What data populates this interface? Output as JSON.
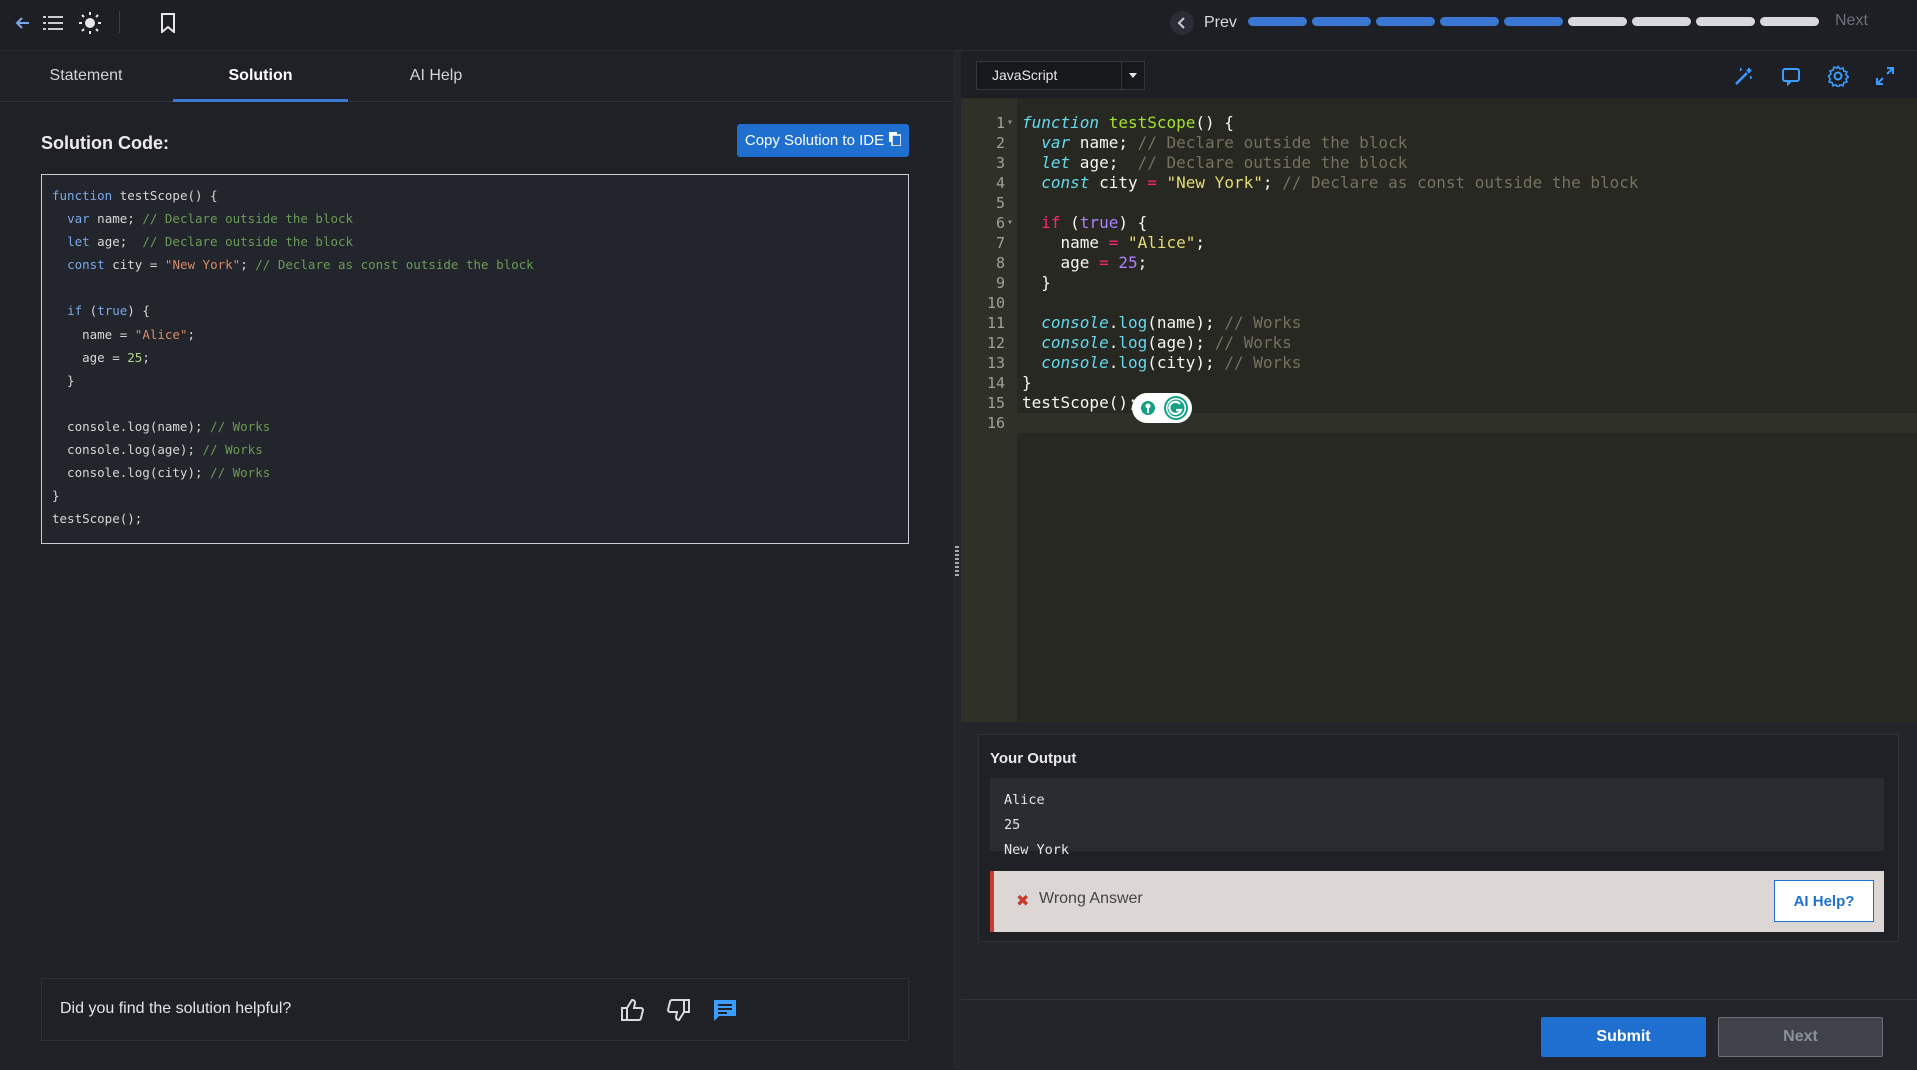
{
  "topbar": {
    "prev_label": "Prev",
    "next_label": "Next",
    "progress": {
      "completed": 5,
      "total": 9
    }
  },
  "tabs": [
    "Statement",
    "Solution",
    "AI Help"
  ],
  "active_tab": "Solution",
  "solution": {
    "title": "Solution Code:",
    "copy_button": "Copy Solution to IDE"
  },
  "feedback": {
    "question": "Did you find the solution helpful?"
  },
  "editor": {
    "language": "JavaScript",
    "line_numbers": [
      "1",
      "2",
      "3",
      "4",
      "5",
      "6",
      "7",
      "8",
      "9",
      "10",
      "11",
      "12",
      "13",
      "14",
      "15",
      "16"
    ]
  },
  "output": {
    "title": "Your Output",
    "lines": [
      "Alice",
      "25",
      "New York"
    ]
  },
  "result": {
    "status": "Wrong Answer",
    "ai_help_button": "AI Help?"
  },
  "actions": {
    "submit": "Submit",
    "next": "Next"
  },
  "colors": {
    "accent": "#1f6fd0",
    "progress_done": "#3a77d3",
    "progress_todo": "#d8d8de",
    "error": "#c73a2e"
  }
}
